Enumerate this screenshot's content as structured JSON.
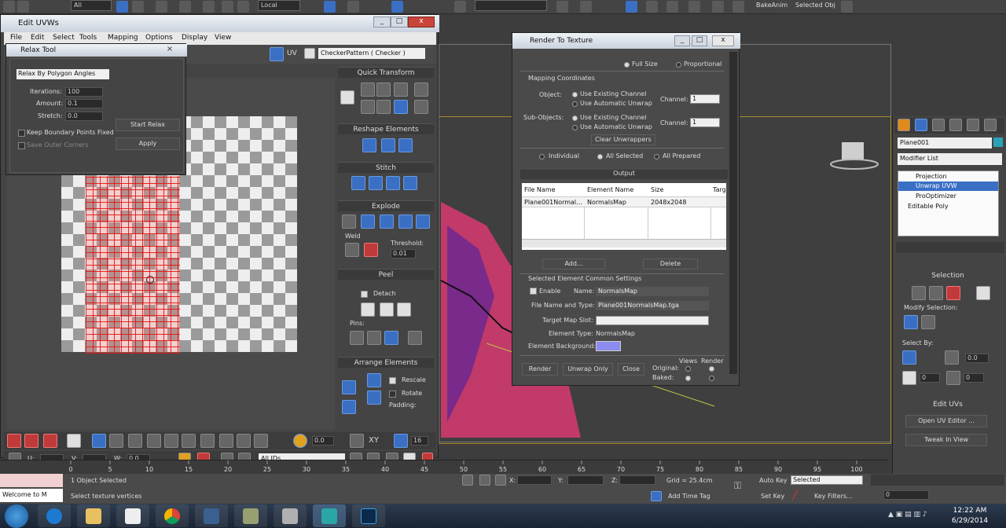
{
  "main_toolbar": {
    "selection_filter": "All",
    "ref_coord": "Local",
    "named_sel": "BakeAnim",
    "named_sel_text": "Selected Obj"
  },
  "uvw_window": {
    "title": "Edit UVWs",
    "menu": [
      "File",
      "Edit",
      "Select",
      "Tools",
      "Mapping",
      "Options",
      "Display",
      "View"
    ],
    "uv_label": "UV",
    "texture_select": "CheckerPattern  ( Checker )",
    "quick_transform": "Quick Transform",
    "reshape": "Reshape Elements",
    "stitch": "Stitch",
    "explode": "Explode",
    "weld": "Weld",
    "threshold_label": "Threshold:",
    "threshold_value": "0.01",
    "peel": "Peel",
    "detach": "Detach",
    "pins": "Pins:",
    "arrange": "Arrange Elements",
    "rescale": "Rescale",
    "rotate": "Rotate",
    "padding": "Padding:",
    "bottom_value": "0.0",
    "xy_label": "XY",
    "xy_value": "16",
    "u_label": "U:",
    "v_label": "V:",
    "w_label": "W:",
    "w_value": "0.0",
    "all_ids": "All IDs"
  },
  "relax_tool": {
    "title": "Relax Tool",
    "method": "Relax By Polygon Angles",
    "iterations_label": "Iterations:",
    "iterations": "100",
    "amount_label": "Amount:",
    "amount": "0.1",
    "stretch_label": "Stretch:",
    "stretch": "0.0",
    "keep_boundary": "Keep Boundary Points Fixed",
    "save_outer": "Save Outer Corners",
    "start_relax": "Start Relax",
    "apply": "Apply"
  },
  "render_to_texture": {
    "title": "Render To Texture",
    "full_size": "Full Size",
    "proportional": "Proportional",
    "mapping_coords": "Mapping Coordinates",
    "object_label": "Object:",
    "use_existing": "Use Existing Channel",
    "use_auto": "Use Automatic Unwrap",
    "channel_label": "Channel:",
    "channel_value": "1",
    "subobjects_label": "Sub-Objects:",
    "clear_unwrappers": "Clear Unwrappers",
    "individual": "Individual",
    "all_selected": "All Selected",
    "all_prepared": "All Prepared",
    "output": "Output",
    "columns": [
      "File Name",
      "Element Name",
      "Size",
      "Targ"
    ],
    "rows": [
      {
        "file": "Plane001Normal...",
        "element": "NormalsMap",
        "size": "2048x2048"
      }
    ],
    "add": "Add...",
    "delete": "Delete",
    "common_settings": "Selected Element Common Settings",
    "enable": "Enable",
    "name_label": "Name:",
    "name_value": "NormalsMap",
    "file_type_label": "File Name and Type:",
    "file_type_value": "Plane001NormalsMap.tga",
    "target_slot": "Target Map Slot:",
    "element_type_label": "Element Type:",
    "element_type": "NormalsMap",
    "element_bg": "Element Background:",
    "views": "Views",
    "render_col": "Render",
    "original": "Original:",
    "baked": "Baked:",
    "render_btn": "Render",
    "unwrap_only": "Unwrap Only",
    "close_btn": "Close"
  },
  "command_panel": {
    "object_name": "Plane001",
    "modifier_list": "Modifier List",
    "stack": [
      "Projection",
      "Unwrap UVW",
      "ProOptimizer",
      "Editable Poly"
    ],
    "selection": "Selection",
    "modify_selection": "Modify Selection:",
    "select_by": "Select By:",
    "value_a": "0.0",
    "value_b": "0",
    "value_c": "0",
    "edit_uvs": "Edit UVs",
    "open_uv_editor": "Open UV Editor ...",
    "tweak_in_view": "Tweak In View"
  },
  "timeline": {
    "ticks": [
      "0",
      "5",
      "10",
      "15",
      "20",
      "25",
      "30",
      "35",
      "40",
      "45",
      "50",
      "55",
      "60",
      "65",
      "70",
      "75",
      "80",
      "85",
      "90",
      "95",
      "100"
    ]
  },
  "status": {
    "welcome": "Welcome to M",
    "objects": "1 Object Selected",
    "prompt": "Select texture vertices",
    "x_label": "X:",
    "y_label": "Y:",
    "z_label": "Z:",
    "grid": "Grid = 25.4cm",
    "add_time_tag": "Add Time Tag",
    "auto_key": "Auto Key",
    "set_key": "Set Key",
    "key_mode": "Selected",
    "key_filters": "Key Filters...",
    "frame": "0"
  },
  "taskbar": {
    "time": "12:22 AM",
    "date": "6/29/2014"
  },
  "colors": {
    "accent_blue": "#3a6fc4",
    "uv_mesh": "#e61414",
    "element_bg": "#8c8cf0"
  }
}
